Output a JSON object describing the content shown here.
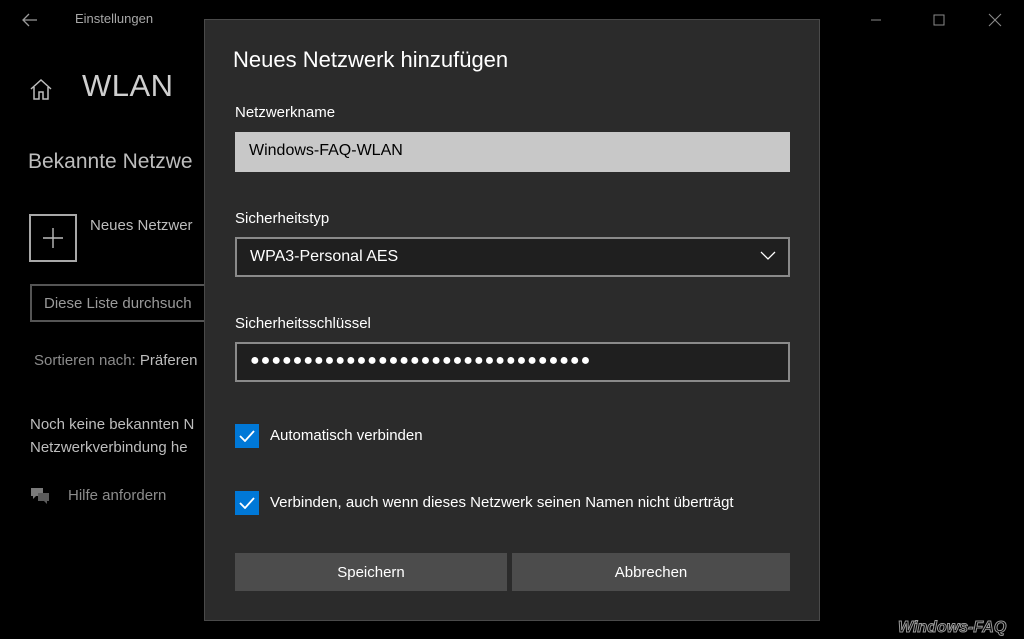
{
  "window": {
    "app_title": "Einstellungen",
    "back_icon": "arrow-left-icon",
    "controls": [
      "minimize-icon",
      "maximize-icon",
      "close-icon"
    ]
  },
  "page": {
    "title": "WLAN",
    "section_title": "Bekannte Netzwe",
    "add_network_label": "Neues Netzwer",
    "search_placeholder": "Diese Liste durchsuch",
    "sort_label": "Sortieren nach:",
    "sort_value": "Präferen",
    "no_networks_line1": "Noch keine bekannten N",
    "no_networks_line2": "Netzwerkverbindung he",
    "help_link": "Hilfe anfordern"
  },
  "dialog": {
    "title": "Neues Netzwerk hinzufügen",
    "network_name_label": "Netzwerkname",
    "network_name_value": "Windows-FAQ-WLAN",
    "security_type_label": "Sicherheitstyp",
    "security_type_value": "WPA3-Personal AES",
    "security_key_label": "Sicherheitsschlüssel",
    "security_key_value": "●●●●●●●●●●●●●●●●●●●●●●●●●●●●●●●●",
    "auto_connect_label": "Automatisch verbinden",
    "auto_connect_checked": true,
    "hidden_connect_label": "Verbinden, auch wenn dieses Netzwerk seinen Namen nicht überträgt",
    "hidden_connect_checked": true,
    "save_button": "Speichern",
    "cancel_button": "Abbrechen"
  },
  "watermark": "Windows-FAQ",
  "colors": {
    "accent": "#0078d7",
    "dialog_bg": "#2b2b2b",
    "page_bg": "#000000",
    "button_bg": "#4c4c4c"
  }
}
